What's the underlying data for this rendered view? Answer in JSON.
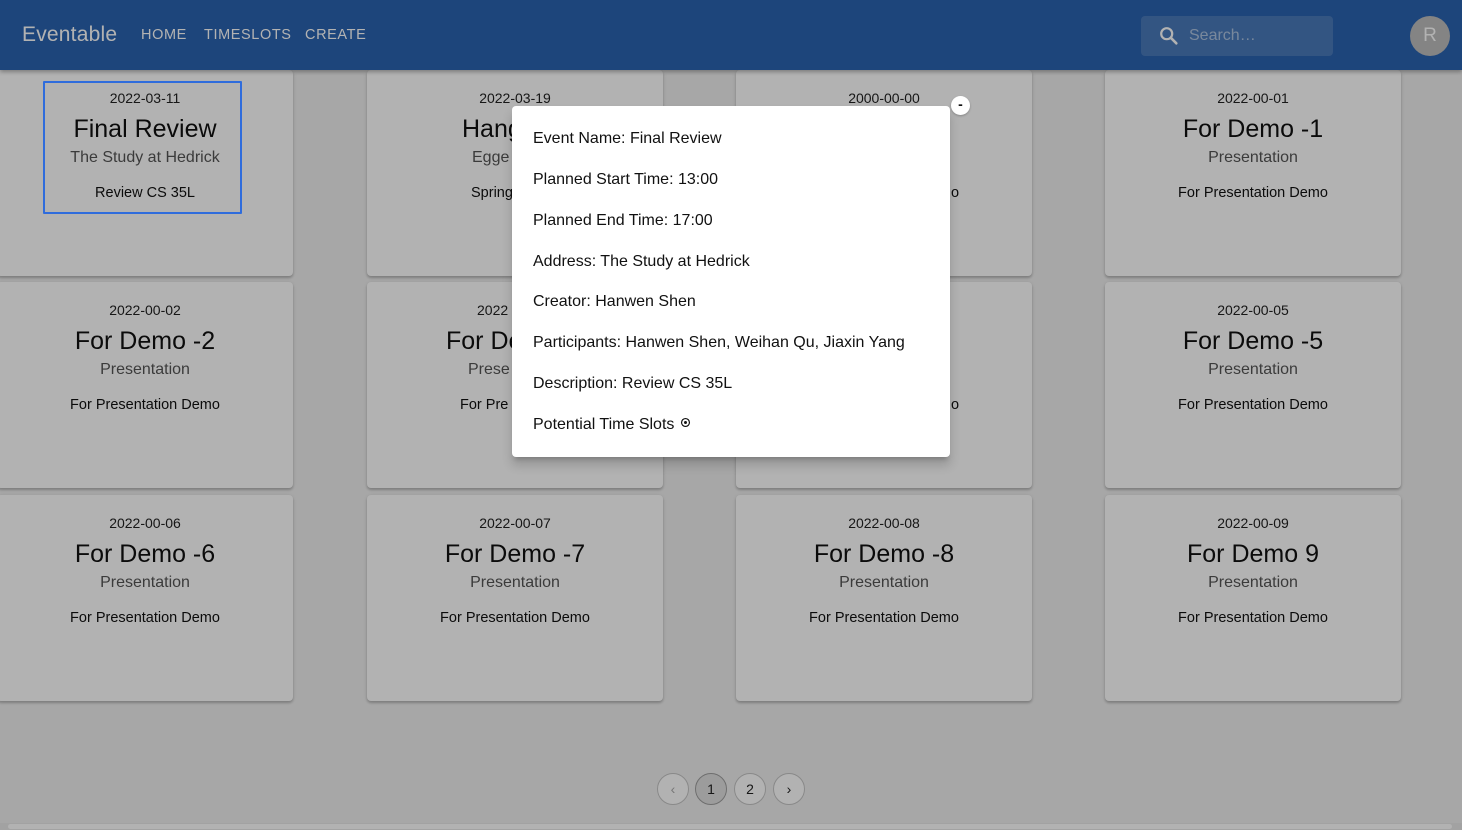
{
  "appbar": {
    "brand": "Eventable",
    "nav": [
      "HOME",
      "TIMESLOTS",
      "CREATE"
    ],
    "search_placeholder": "Search…",
    "avatar_initial": "R",
    "color": "#2a63b0"
  },
  "cards": [
    {
      "date": "2022-03-11",
      "title": "Final Review",
      "address": "The Study at Hedrick",
      "description": "Review CS 35L"
    },
    {
      "date": "2022-03-19",
      "title": "Hang",
      "address": "Egge",
      "description": "Spring"
    },
    {
      "date": "2000-00-00",
      "title": "",
      "address": "",
      "description": "o"
    },
    {
      "date": "2022-00-01",
      "title": "For Demo -1",
      "address": "Presentation",
      "description": "For Presentation Demo"
    },
    {
      "date": "2022-00-02",
      "title": "For Demo -2",
      "address": "Presentation",
      "description": "For Presentation Demo"
    },
    {
      "date": "2022",
      "title": "For De",
      "address": "Prese",
      "description": "For Pre"
    },
    {
      "date": "",
      "title": "",
      "address": "",
      "description": "o"
    },
    {
      "date": "2022-00-05",
      "title": "For Demo -5",
      "address": "Presentation",
      "description": "For Presentation Demo"
    },
    {
      "date": "2022-00-06",
      "title": "For Demo -6",
      "address": "Presentation",
      "description": "For Presentation Demo"
    },
    {
      "date": "2022-00-07",
      "title": "For Demo -7",
      "address": "Presentation",
      "description": "For Presentation Demo"
    },
    {
      "date": "2022-00-08",
      "title": "For Demo -8",
      "address": "Presentation",
      "description": "For Presentation Demo"
    },
    {
      "date": "2022-00-09",
      "title": "For Demo 9",
      "address": "Presentation",
      "description": "For Presentation Demo"
    }
  ],
  "pagination": {
    "prev": "‹",
    "pages": [
      "1",
      "2"
    ],
    "current": "1",
    "next": "›"
  },
  "popover": {
    "collapse_label": "-",
    "lines": [
      {
        "key": "Event Name: ",
        "value": "Final Review"
      },
      {
        "key": "Planned Start Time: ",
        "value": "13:00"
      },
      {
        "key": "Planned End Time: ",
        "value": "17:00"
      },
      {
        "key": "Address: ",
        "value": "The Study at Hedrick"
      },
      {
        "key": "Creator: ",
        "value": "Hanwen Shen"
      },
      {
        "key": "Participants: ",
        "value": "Hanwen Shen, Weihan Qu, Jiaxin Yang"
      },
      {
        "key": "Description: ",
        "value": "Review CS 35L"
      }
    ],
    "timeslots_label": "Potential Time Slots",
    "timeslots_icon": "eye-icon"
  }
}
